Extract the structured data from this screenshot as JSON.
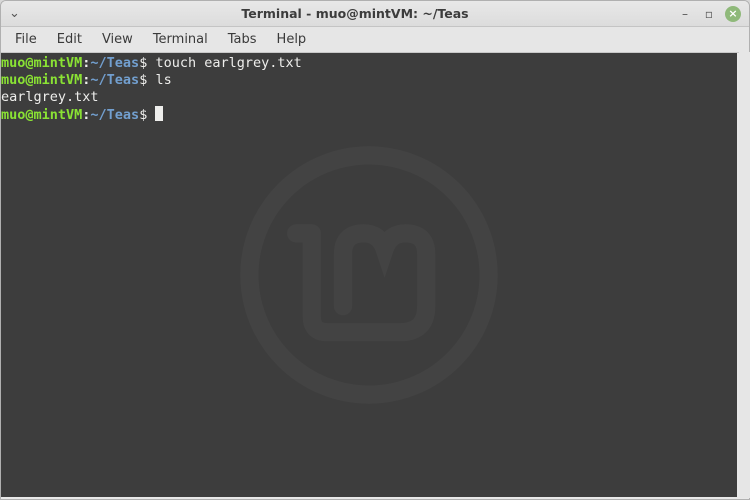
{
  "window": {
    "title": "Terminal - muo@mintVM: ~/Teas"
  },
  "menubar": {
    "items": [
      "File",
      "Edit",
      "View",
      "Terminal",
      "Tabs",
      "Help"
    ]
  },
  "prompt": {
    "user_host": "muo@mintVM",
    "colon": ":",
    "path": "~/Teas",
    "sigil": "$"
  },
  "lines": [
    {
      "type": "cmd",
      "command": " touch earlgrey.txt"
    },
    {
      "type": "cmd",
      "command": " ls"
    },
    {
      "type": "out",
      "text": "earlgrey.txt"
    },
    {
      "type": "cmd",
      "command": " ",
      "cursor": true
    }
  ]
}
